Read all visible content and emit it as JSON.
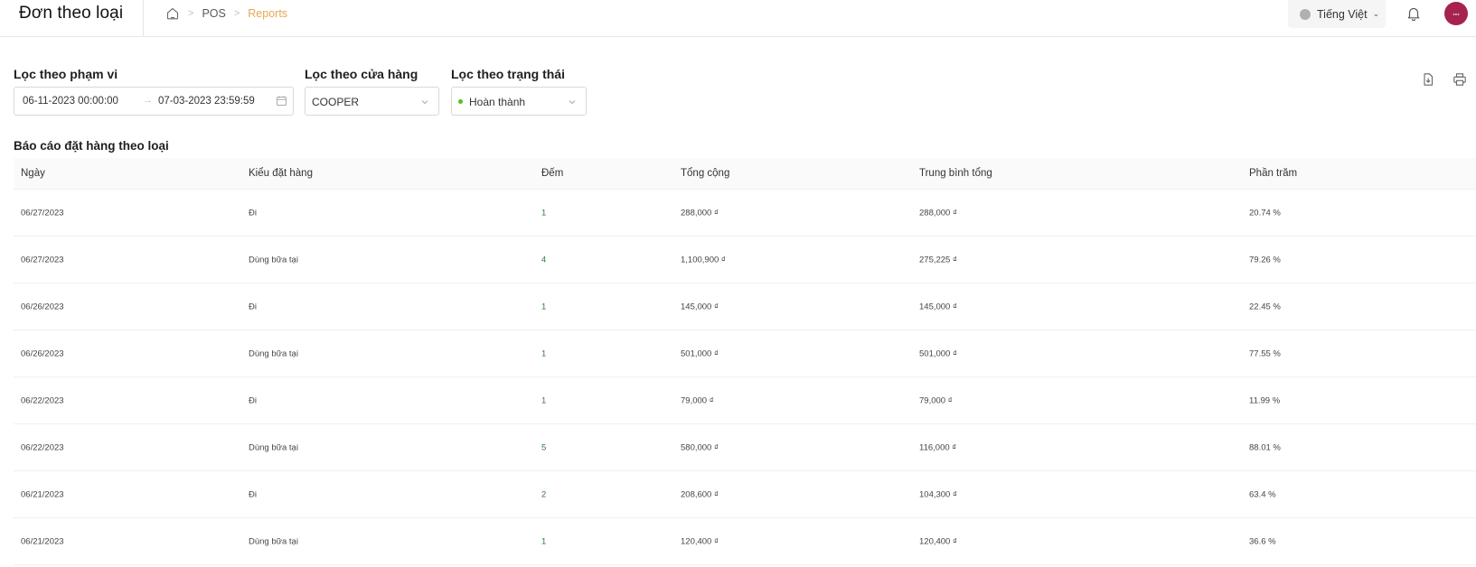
{
  "header": {
    "title": "Đơn theo loại",
    "breadcrumb": [
      {
        "label": "POS"
      },
      {
        "label": "Reports"
      }
    ],
    "language": "Tiếng Việt"
  },
  "filters": {
    "range": {
      "label": "Lọc theo phạm vi",
      "start": "06-11-2023 00:00:00",
      "end": "07-03-2023 23:59:59"
    },
    "store": {
      "label": "Lọc theo cửa hàng",
      "value": "COOPER"
    },
    "status": {
      "label": "Lọc theo trạng thái",
      "value": "Hoàn thành"
    }
  },
  "report": {
    "title": "Báo cáo đặt hàng theo loại",
    "columns": [
      "Ngày",
      "Kiểu đặt hàng",
      "Đếm",
      "Tổng cộng",
      "Trung bình tổng",
      "Phần trăm"
    ],
    "rows": [
      {
        "date": "06/27/2023",
        "type": "Đi",
        "count": "1",
        "total": "288,000 ₫",
        "avg": "288,000 ₫",
        "percent": "20.74 %"
      },
      {
        "date": "06/27/2023",
        "type": "Dùng bữa tại",
        "count": "4",
        "total": "1,100,900 ₫",
        "avg": "275,225 ₫",
        "percent": "79.26 %"
      },
      {
        "date": "06/26/2023",
        "type": "Đi",
        "count": "1",
        "total": "145,000 ₫",
        "avg": "145,000 ₫",
        "percent": "22.45 %"
      },
      {
        "date": "06/26/2023",
        "type": "Dùng bữa tại",
        "count": "1",
        "total": "501,000 ₫",
        "avg": "501,000 ₫",
        "percent": "77.55 %"
      },
      {
        "date": "06/22/2023",
        "type": "Đi",
        "count": "1",
        "total": "79,000 ₫",
        "avg": "79,000 ₫",
        "percent": "11.99 %"
      },
      {
        "date": "06/22/2023",
        "type": "Dùng bữa tại",
        "count": "5",
        "total": "580,000 ₫",
        "avg": "116,000 ₫",
        "percent": "88.01 %"
      },
      {
        "date": "06/21/2023",
        "type": "Đi",
        "count": "2",
        "total": "208,600 ₫",
        "avg": "104,300 ₫",
        "percent": "63.4 %"
      },
      {
        "date": "06/21/2023",
        "type": "Dùng bữa tại",
        "count": "1",
        "total": "120,400 ₫",
        "avg": "120,400 ₫",
        "percent": "36.6 %"
      }
    ]
  },
  "colors": {
    "accent": "#e8a651",
    "count_green": "#2f7d32",
    "avatar": "#a6234d",
    "status_dot": "#52c41a"
  },
  "icons": [
    "home-icon",
    "calendar-icon",
    "chevron-down-icon",
    "bell-icon",
    "download-icon",
    "print-icon"
  ]
}
